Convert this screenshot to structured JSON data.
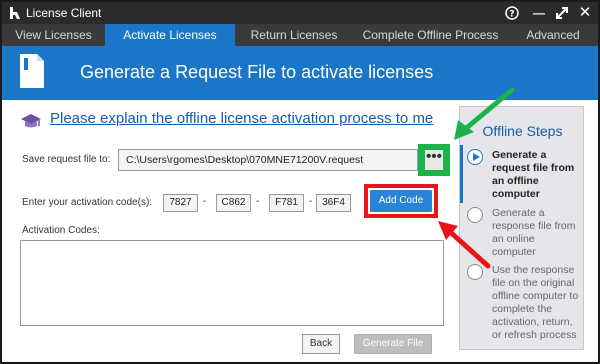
{
  "window": {
    "title": "License Client",
    "help_glyph": "?",
    "minimize_glyph": "—",
    "restore_glyph": "⤢",
    "close_glyph": "✕"
  },
  "tabs": [
    {
      "label": "View Licenses",
      "active": false
    },
    {
      "label": "Activate Licenses",
      "active": true
    },
    {
      "label": "Return Licenses",
      "active": false
    },
    {
      "label": "Complete Offline Process",
      "active": false
    },
    {
      "label": "Advanced",
      "active": false
    }
  ],
  "banner": {
    "heading": "Generate a Request File to activate licenses",
    "icon": "document-icon"
  },
  "help": {
    "icon": "graduation-cap-icon",
    "link_text": "Please explain the offline license activation process to me"
  },
  "form": {
    "save_label": "Save request file to:",
    "save_path": "C:\\Users\\rgomes\\Desktop\\070MNE71200V.request",
    "browse_label": "•••",
    "code_label": "Enter your activation code(s):",
    "code_parts": [
      "7827",
      "C862",
      "F781",
      "36F4"
    ],
    "code_separator": "-",
    "add_code_label": "Add Code",
    "codes_label": "Activation Codes:",
    "codes_value": ""
  },
  "footer": {
    "back_label": "Back",
    "generate_label": "Generate File"
  },
  "steps": {
    "heading": "Offline Steps",
    "items": [
      {
        "text": "Generate a request file from an offline computer",
        "active": true
      },
      {
        "text": "Generate a response file from an online computer",
        "active": false
      },
      {
        "text": "Use the response file on the original offline computer to complete the activation, return, or refresh process",
        "active": false
      }
    ]
  },
  "colors": {
    "accent": "#1a76c8",
    "annotation_green": "#1db34a",
    "annotation_red": "#e8161c",
    "titlebar": "#2b2b2b"
  }
}
